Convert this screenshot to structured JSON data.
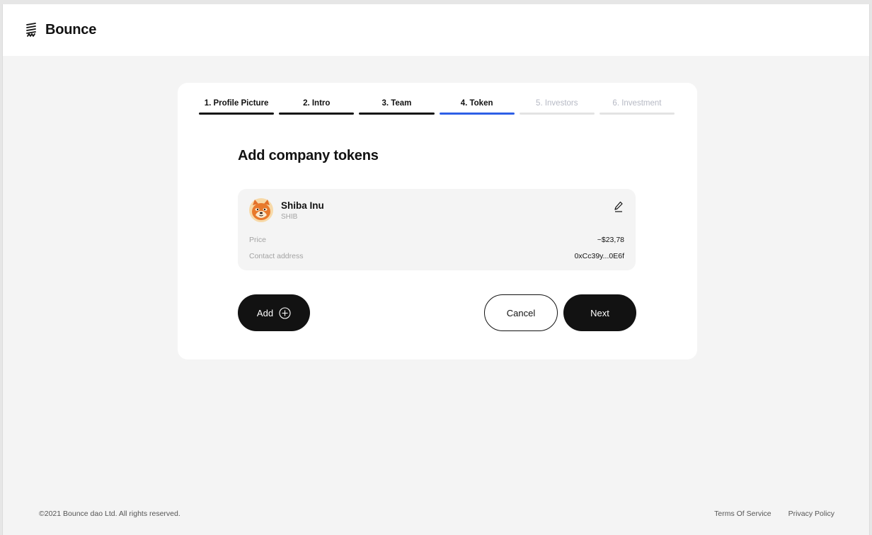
{
  "brand": {
    "name": "Bounce",
    "logo_icon": "bounce-logo-icon"
  },
  "steps": [
    {
      "label": "1. Profile Picture",
      "state": "done"
    },
    {
      "label": "2. Intro",
      "state": "done"
    },
    {
      "label": "3. Team",
      "state": "done"
    },
    {
      "label": "4. Token",
      "state": "active"
    },
    {
      "label": "5. Investors",
      "state": "pending"
    },
    {
      "label": "6. Investment",
      "state": "pending"
    }
  ],
  "page": {
    "title": "Add company tokens"
  },
  "token": {
    "name": "Shiba Inu",
    "symbol": "SHIB",
    "avatar_icon": "shiba-inu-icon",
    "edit_icon": "pencil-icon",
    "price_label": "Price",
    "price_value": "~$23,78",
    "address_label": "Contact address",
    "address_value": "0xCc39y...0E6f"
  },
  "actions": {
    "add_label": "Add",
    "add_icon": "plus-circle-icon",
    "cancel_label": "Cancel",
    "next_label": "Next"
  },
  "footer": {
    "copyright": "©2021 Bounce dao Ltd. All rights reserved.",
    "terms": "Terms Of Service",
    "privacy": "Privacy Policy"
  },
  "colors": {
    "accent": "#2e5fe6",
    "dark": "#121212",
    "background": "#f4f4f4"
  }
}
